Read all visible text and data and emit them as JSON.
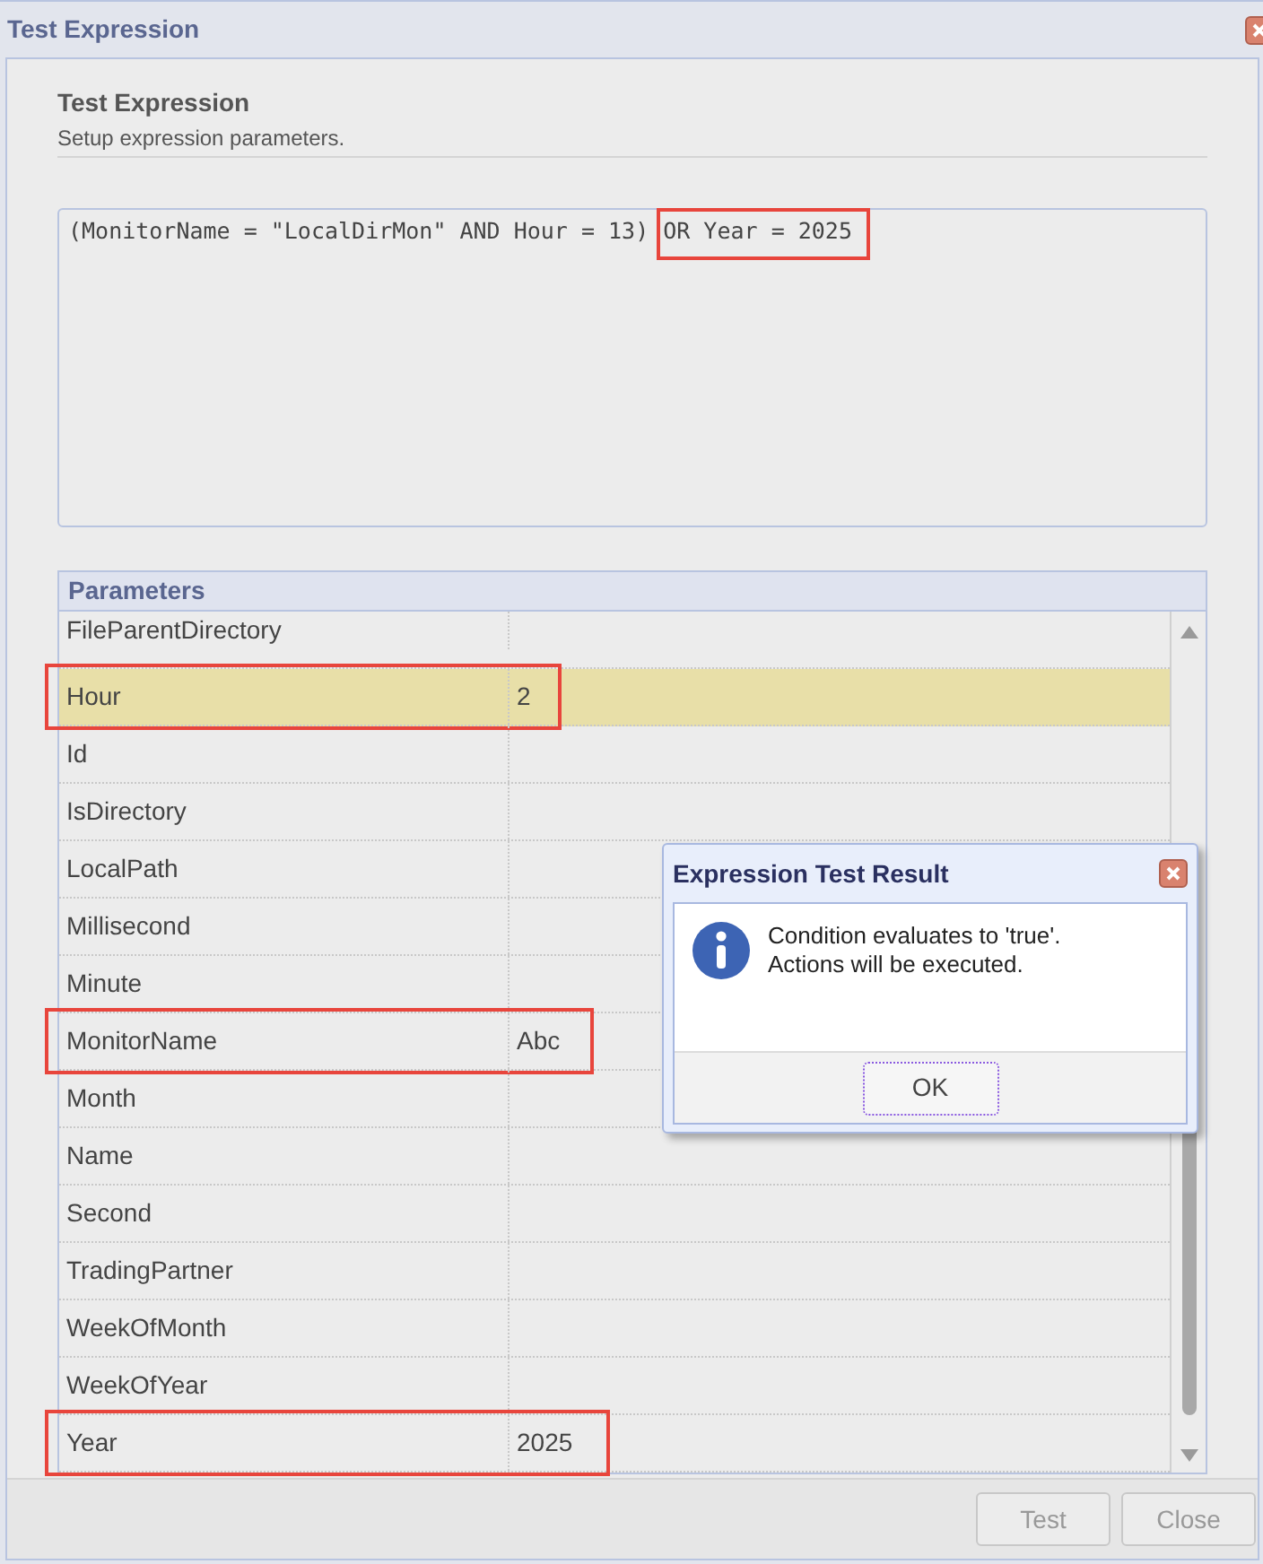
{
  "window": {
    "title": "Test Expression"
  },
  "header": {
    "title": "Test Expression",
    "subtitle": "Setup expression parameters."
  },
  "expression": [
    {
      "text": "(MonitorName = \"LocalDirMon\" AND Hour = 13)",
      "highlighted": false
    },
    {
      "text": "OR Year = 2025",
      "highlighted": true
    }
  ],
  "parameters": {
    "title": "Parameters",
    "rows": [
      {
        "name": "FileParentDirectory",
        "value": "",
        "selected": false,
        "highlighted": false
      },
      {
        "name": "Hour",
        "value": "2",
        "selected": true,
        "highlighted": true
      },
      {
        "name": "Id",
        "value": "",
        "selected": false,
        "highlighted": false
      },
      {
        "name": "IsDirectory",
        "value": "",
        "selected": false,
        "highlighted": false
      },
      {
        "name": "LocalPath",
        "value": "",
        "selected": false,
        "highlighted": false
      },
      {
        "name": "Millisecond",
        "value": "",
        "selected": false,
        "highlighted": false
      },
      {
        "name": "Minute",
        "value": "",
        "selected": false,
        "highlighted": false
      },
      {
        "name": "MonitorName",
        "value": "Abc",
        "selected": false,
        "highlighted": true
      },
      {
        "name": "Month",
        "value": "",
        "selected": false,
        "highlighted": false
      },
      {
        "name": "Name",
        "value": "",
        "selected": false,
        "highlighted": false
      },
      {
        "name": "Second",
        "value": "",
        "selected": false,
        "highlighted": false
      },
      {
        "name": "TradingPartner",
        "value": "",
        "selected": false,
        "highlighted": false
      },
      {
        "name": "WeekOfMonth",
        "value": "",
        "selected": false,
        "highlighted": false
      },
      {
        "name": "WeekOfYear",
        "value": "",
        "selected": false,
        "highlighted": false
      },
      {
        "name": "Year",
        "value": "2025",
        "selected": false,
        "highlighted": true
      }
    ]
  },
  "buttons": [
    {
      "label": "Test"
    },
    {
      "label": "Close"
    }
  ],
  "result_dialog": {
    "title": "Expression Test Result",
    "message_lines": [
      "Condition evaluates to 'true'.",
      "Actions will be executed."
    ],
    "button": "OK"
  }
}
